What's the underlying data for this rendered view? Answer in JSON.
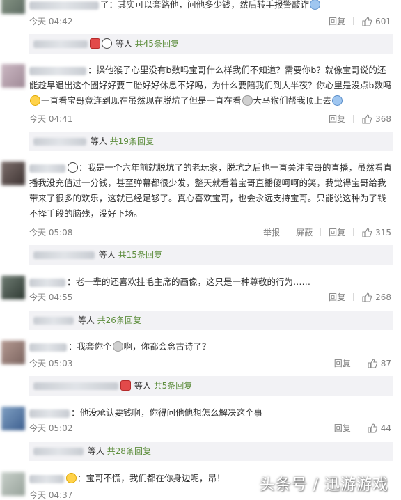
{
  "actions": {
    "reply": "回复",
    "report": "举报",
    "block": "屏蔽"
  },
  "comments": [
    {
      "text": "了：其实可以套路他，问他多少钱，然后转手报警敲诈",
      "time": "今天 04:42",
      "likes": "601"
    },
    {
      "reply_summary": {
        "suffix": "等人",
        "count": "共45条回复"
      }
    },
    {
      "text": "：操他猴子心里没有b数吗宝哥什么样我们不知道？需要你b？就像宝哥说的还能趁早退出这个圈好好要二胎好好休息不好吗，为什么要陪我们到大半夜？你心里是没点b数吗",
      "text_tail": "一直看宝哥竟连到现在虽然现在脱坑了但是一直在看",
      "text_end": "大马猴们帮我顶上去",
      "time": "今天 04:41",
      "likes": "368"
    },
    {
      "reply_summary": {
        "suffix": "等人",
        "count": "共19条回复"
      }
    },
    {
      "text": "：我是一个六年前就脱坑了的老玩家，脱坑之后也一直关注宝哥的直播，虽然看直播我没充值过一分钱，甚至弹幕都很少发，整天就看着宝哥直播傻呵呵的笑，我觉得宝哥给我带来了很多的欢乐，这就已经足够了。真心喜欢宝哥，也会永远支持宝哥。只能说这种为了钱不择手段的脑残，没好下场。",
      "time": "今天 05:08",
      "likes": "315"
    },
    {
      "reply_summary": {
        "suffix": "等人",
        "count": "共15条回复"
      }
    },
    {
      "text": "：老一辈的还喜欢挂毛主席的画像，这只是一种尊敬的行为……",
      "time": "今天 04:55",
      "likes": "268"
    },
    {
      "reply_summary": {
        "suffix": "等人",
        "count": "共26条回复"
      }
    },
    {
      "text": "：我套你个",
      "text_end": "啊，你都会念古诗了？",
      "time": "今天 05:03",
      "likes": "87"
    },
    {
      "reply_summary": {
        "suffix": "等人",
        "count": "共5条回复"
      }
    },
    {
      "text": "：他没承认要钱啊，你得问他他想怎么解决这个事",
      "time": "今天 05:02",
      "likes": "44"
    },
    {
      "reply_summary": {
        "suffix": "等人",
        "count": "共28条回复"
      }
    },
    {
      "text": "：宝哥不慌，我们都在你身边呢，昂！",
      "time": "今天 04:37"
    }
  ],
  "watermark": "头条号 / 迅游游戏",
  "colors": {
    "reply_count": "#5f8f3f",
    "reply_bar_bg": "#f2f2f5",
    "meta_text": "#808080"
  }
}
